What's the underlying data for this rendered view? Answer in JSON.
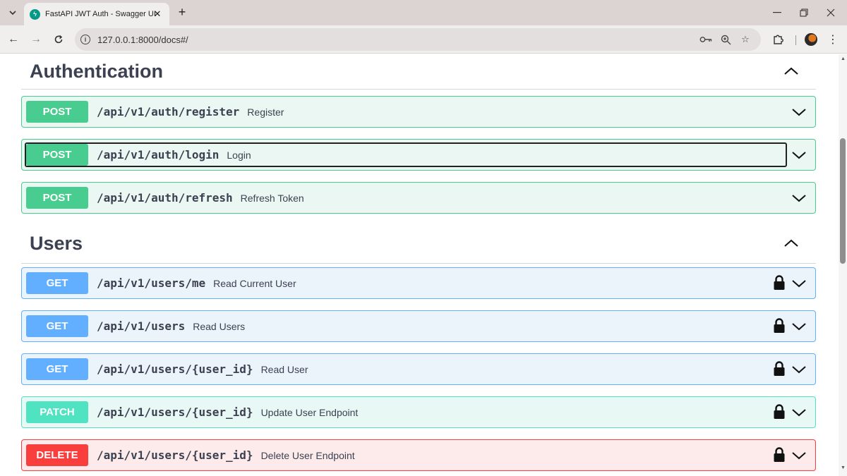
{
  "browser": {
    "tab_title": "FastAPI JWT Auth - Swagger UI",
    "tab_favicon": "fastapi-icon",
    "url": "127.0.0.1:8000/docs#/",
    "icons": [
      "tab-list-chevron-icon",
      "close-icon",
      "plus-icon",
      "minimize-icon",
      "restore-icon",
      "window-close-icon",
      "back-arrow-icon",
      "forward-arrow-icon",
      "reload-icon",
      "site-info-icon",
      "password-key-icon",
      "zoom-icon",
      "star-icon",
      "extensions-puzzle-icon",
      "profile-avatar",
      "more-vert-icon"
    ]
  },
  "sections": [
    {
      "title": "Authentication",
      "ops": [
        {
          "method": "POST",
          "path": "/api/v1/auth/register",
          "summary": "Register",
          "locked": false
        },
        {
          "method": "POST",
          "path": "/api/v1/auth/login",
          "summary": "Login",
          "locked": false,
          "focused": true
        },
        {
          "method": "POST",
          "path": "/api/v1/auth/refresh",
          "summary": "Refresh Token",
          "locked": false
        }
      ]
    },
    {
      "title": "Users",
      "ops": [
        {
          "method": "GET",
          "path": "/api/v1/users/me",
          "summary": "Read Current User",
          "locked": true
        },
        {
          "method": "GET",
          "path": "/api/v1/users",
          "summary": "Read Users",
          "locked": true
        },
        {
          "method": "GET",
          "path": "/api/v1/users/{user_id}",
          "summary": "Read User",
          "locked": true
        },
        {
          "method": "PATCH",
          "path": "/api/v1/users/{user_id}",
          "summary": "Update User Endpoint",
          "locked": true
        },
        {
          "method": "DELETE",
          "path": "/api/v1/users/{user_id}",
          "summary": "Delete User Endpoint",
          "locked": true
        }
      ]
    }
  ],
  "colors": {
    "post": "#49cc90",
    "get": "#61affe",
    "patch": "#50e3c2",
    "delete": "#f93e3e",
    "text": "#3b4151"
  }
}
